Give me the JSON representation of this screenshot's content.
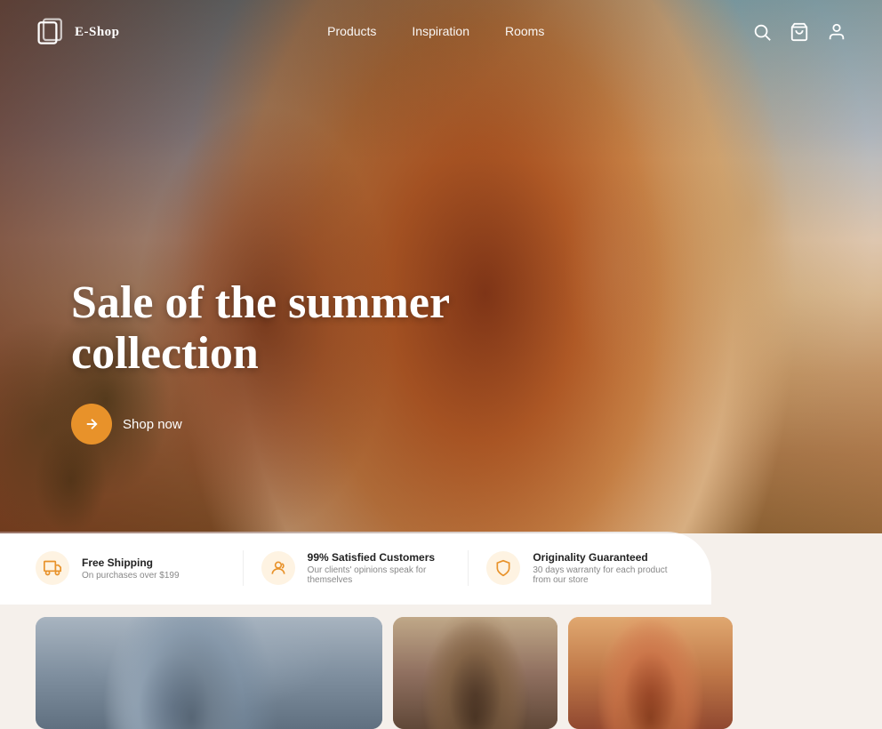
{
  "nav": {
    "logo_text": "E-Shop",
    "links": [
      {
        "label": "Products",
        "href": "#"
      },
      {
        "label": "Inspiration",
        "href": "#"
      },
      {
        "label": "Rooms",
        "href": "#"
      }
    ],
    "search_label": "Search",
    "cart_label": "Cart",
    "user_label": "User"
  },
  "hero": {
    "title_line1": "Sale of the summer",
    "title_line2": "collection",
    "cta_label": "Shop now"
  },
  "features": [
    {
      "icon": "box",
      "title": "Free Shipping",
      "description": "On purchases over $199"
    },
    {
      "icon": "face",
      "title": "99% Satisfied Customers",
      "description": "Our clients' opinions speak for themselves"
    },
    {
      "icon": "shield",
      "title": "Originality Guaranteed",
      "description": "30 days warranty for each product from our store"
    }
  ],
  "nav_prev": "←",
  "nav_next": "→",
  "cards": [
    {
      "alt": "Summer fashion card 1"
    },
    {
      "alt": "Summer fashion card 2"
    },
    {
      "alt": "Summer fashion card 3"
    }
  ]
}
